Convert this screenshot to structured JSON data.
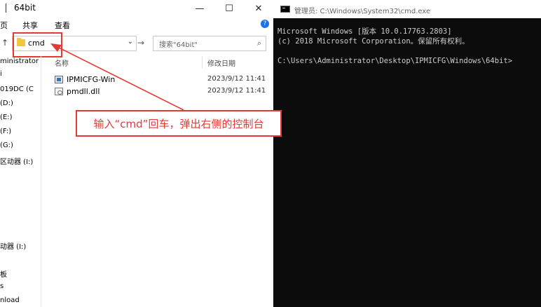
{
  "explorer": {
    "title": "64bit",
    "window_controls": {
      "minimize": "—",
      "maximize": "☐",
      "close": "✕"
    },
    "menu": {
      "page": "页",
      "share": "共享",
      "view": "查看",
      "help": "?"
    },
    "address": {
      "value": "cmd",
      "up": "↑",
      "dropdown": "⌄",
      "go": "→"
    },
    "search": {
      "placeholder": "搜索\"64bit\"",
      "icon": "⌕"
    },
    "nav_items": [
      "ministrator",
      "i",
      "019DC (C",
      "(D:)",
      "(E:)",
      "(F:)",
      "(G:)",
      "区动器 (I:)",
      "动器 (I:)",
      "板",
      "s",
      "nload"
    ],
    "columns": {
      "name": "名称",
      "date": "修改日期"
    },
    "files": [
      {
        "name": "IPMICFG-Win",
        "date": "2023/9/12 11:41",
        "icon": "exe-icon"
      },
      {
        "name": "pmdll.dll",
        "date": "2023/9/12 11:41",
        "icon": "dll-icon"
      }
    ]
  },
  "annotation": {
    "callout_text": "输入“cmd”回车，弹出右侧的控制台",
    "color": "#e53935"
  },
  "cmd": {
    "title": "管理员: C:\\Windows\\System32\\cmd.exe",
    "lines": [
      "Microsoft Windows [版本 10.0.17763.2803]",
      "(c) 2018 Microsoft Corporation。保留所有权利。",
      "",
      "C:\\Users\\Administrator\\Desktop\\IPMICFG\\Windows\\64bit>"
    ]
  }
}
